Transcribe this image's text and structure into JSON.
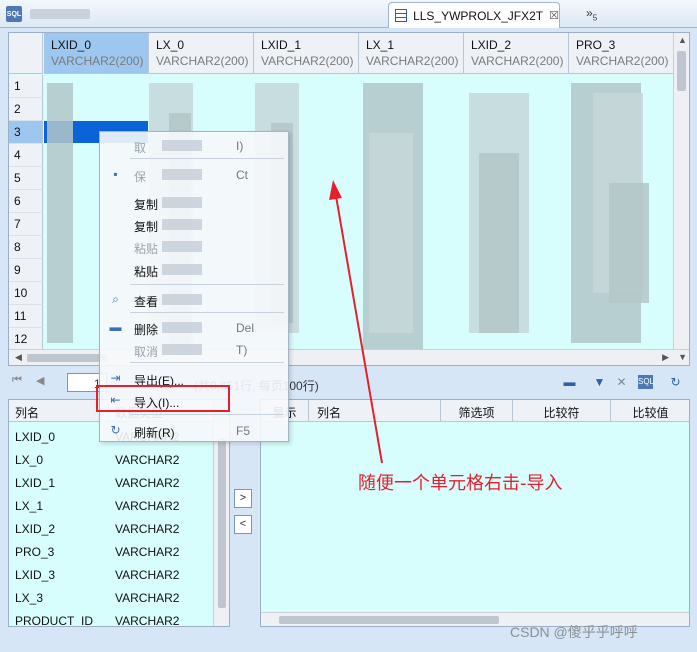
{
  "tabs": {
    "active_title": "LLS_YWPROLX_JFX2T",
    "close_glyph": "☒",
    "overflow_label": "»",
    "overflow_count": "5"
  },
  "grid": {
    "columns": [
      {
        "name": "LXID_0",
        "type": "VARCHAR2(200)"
      },
      {
        "name": "LX_0",
        "type": "VARCHAR2(200)"
      },
      {
        "name": "LXID_1",
        "type": "VARCHAR2(200)"
      },
      {
        "name": "LX_1",
        "type": "VARCHAR2(200)"
      },
      {
        "name": "LXID_2",
        "type": "VARCHAR2(200)"
      },
      {
        "name": "PRO_3",
        "type": "VARCHAR2(200)"
      }
    ],
    "rows": [
      "1",
      "2",
      "3",
      "4",
      "5",
      "6",
      "7",
      "8",
      "9",
      "10",
      "11",
      "12"
    ],
    "selected_row": "3"
  },
  "context_menu": {
    "items": [
      {
        "label": "取",
        "shortcut": "I)",
        "disabled": true,
        "icon": ""
      },
      {
        "label": "保",
        "shortcut": "Ct",
        "disabled": true,
        "icon": "save-icon"
      },
      {
        "label": "复制",
        "shortcut": "",
        "disabled": false,
        "icon": ""
      },
      {
        "label": "复制",
        "shortcut": "",
        "disabled": false,
        "icon": ""
      },
      {
        "label": "粘贴",
        "shortcut": "",
        "disabled": true,
        "icon": ""
      },
      {
        "label": "粘贴",
        "shortcut": "",
        "disabled": false,
        "icon": ""
      },
      {
        "label": "查看",
        "shortcut": "",
        "disabled": false,
        "icon": "search-icon"
      },
      {
        "label": "删除",
        "shortcut": "Del",
        "disabled": false,
        "icon": "delete-icon"
      },
      {
        "label": "取消",
        "shortcut": "T)",
        "disabled": true,
        "icon": ""
      },
      {
        "label": "导出(E)...",
        "shortcut": "",
        "disabled": false,
        "icon": "export-icon"
      },
      {
        "label": "导入(I)...",
        "shortcut": "",
        "disabled": false,
        "icon": "import-icon"
      },
      {
        "label": "刷新(R)",
        "shortcut": "F5",
        "disabled": false,
        "icon": "refresh-icon"
      }
    ]
  },
  "pager": {
    "current_page": "1",
    "info": "(共0,651行, 每页100行)"
  },
  "column_list": {
    "headers": {
      "name": "列名",
      "type": "数据类型"
    },
    "rows": [
      {
        "name": "LXID_0",
        "type": "VARCHAR2"
      },
      {
        "name": "LX_0",
        "type": "VARCHAR2"
      },
      {
        "name": "LXID_1",
        "type": "VARCHAR2"
      },
      {
        "name": "LX_1",
        "type": "VARCHAR2"
      },
      {
        "name": "LXID_2",
        "type": "VARCHAR2"
      },
      {
        "name": "PRO_3",
        "type": "VARCHAR2"
      },
      {
        "name": "LXID_3",
        "type": "VARCHAR2"
      },
      {
        "name": "LX_3",
        "type": "VARCHAR2"
      },
      {
        "name": "PRODUCT_ID",
        "type": "VARCHAR2"
      }
    ]
  },
  "transfer": {
    "add": ">",
    "remove": "<"
  },
  "filter_panel": {
    "headers": {
      "show": "显示",
      "name": "列名",
      "op": "筛选项",
      "compare": "比较符",
      "value": "比较值"
    }
  },
  "annotation": {
    "text": "随便一个单元格右击-导入",
    "color": "#e5202e"
  },
  "watermark": "CSDN @傻乎乎呼呼"
}
